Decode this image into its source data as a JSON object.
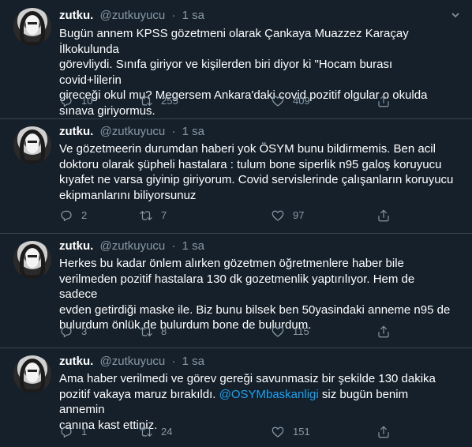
{
  "tweets": [
    {
      "name": "zutku.",
      "handle": "@zutkuyucu",
      "dot": "·",
      "time": "1 sa",
      "text": "Bugün annem KPSS gözetmeni olarak Çankaya Muazzez Karaçay İlkokulunda görevliydi. Sınıfa giriyor ve kişilerden biri diyor ki \"Hocam burası covid+lilerin gireceği okul mu? Megersem Ankara'daki covid pozitif olgular o okulda sınava giriyormus.",
      "lines": [
        "Bugün annem KPSS gözetmeni olarak Çankaya Muazzez Karaçay İlkokulunda",
        "görevliydi. Sınıfa giriyor ve kişilerden biri diyor ki \"Hocam burası covid+lilerin",
        "gireceği okul mu? Megersem Ankara'daki covid pozitif olgular o okulda",
        "sınava giriyormus."
      ],
      "replies": "10",
      "retweets": "255",
      "likes": "409"
    },
    {
      "name": "zutku.",
      "handle": "@zutkuyucu",
      "dot": "·",
      "time": "1 sa",
      "lines": [
        "Ve gözetmeerin durumdan haberi yok ÖSYM bunu bildirmemis. Ben acil",
        "doktoru olarak şüpheli hastalara : tulum bone siperlik n95 galoş koruyucu",
        "kıyafet ne varsa giyinip giriyorum. Covid servislerinde çalışanların koruyucu",
        "ekipmanlarını biliyorsunuz"
      ],
      "replies": "2",
      "retweets": "7",
      "likes": "97"
    },
    {
      "name": "zutku.",
      "handle": "@zutkuyucu",
      "dot": "·",
      "time": "1 sa",
      "lines": [
        "Herkes bu kadar önlem alırken gözetmen öğretmenlere haber bile",
        "verilmeden pozitif hastalara 130 dk gozetmenlik yaptırılıyor. Hem de sadece",
        "evden getirdiği maske ile. Biz bunu bilsek ben 50yasindaki anneme n95 de",
        "bulurdum önlük de bulurdum bone de bulurdum."
      ],
      "replies": "3",
      "retweets": "8",
      "likes": "115"
    },
    {
      "name": "zutku.",
      "handle": "@zutkuyucu",
      "dot": "·",
      "time": "1 sa",
      "lines_pre": "Ama haber verilmedi ve görev gereği savunmasiz bir şekilde 130 dakika",
      "line2_pre": "pozitif vakaya maruz bırakıldı. ",
      "mention": "@OSYMbaskanligi",
      "line2_post": " siz bugün benim annemin",
      "line3": "canına kast ettiniz.",
      "replies": "1",
      "retweets": "24",
      "likes": "151"
    }
  ],
  "colors": {
    "background": "#15202b",
    "secondary_text": "#8899a6",
    "link": "#1da1f2",
    "divider": "#38444d"
  },
  "icons": [
    "reply-icon",
    "retweet-icon",
    "like-icon",
    "share-icon",
    "chevron-down-icon"
  ]
}
